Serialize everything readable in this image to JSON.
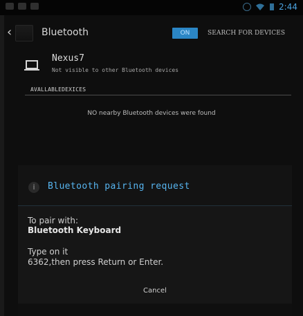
{
  "status_bar": {
    "time": "2:44",
    "icons": [
      "notification-icon",
      "headset-icon",
      "image-icon",
      "sync-icon",
      "wifi-icon",
      "battery-icon"
    ]
  },
  "action_bar": {
    "title": "Bluetooth",
    "toggle_label": "ON",
    "search_label": "SEARCH FOR DEVICES"
  },
  "device": {
    "name": "Nexus7",
    "status": "Not visible to other Bluetooth devices"
  },
  "available": {
    "header": "AVALLABLEDEXICES",
    "empty_message": "NO nearby Bluetooth devices were found"
  },
  "dialog": {
    "title": "Bluetooth pairing request",
    "pair_with_label": "To pair with:",
    "device_name": "Bluetooth Keyboard",
    "instruction": "Type on it",
    "code_instruction": "6362,then press Return or Enter.",
    "cancel_label": "Cancel"
  },
  "colors": {
    "accent": "#57b5f0",
    "toggle": "#2b86c5",
    "background": "#0e0e0e"
  }
}
